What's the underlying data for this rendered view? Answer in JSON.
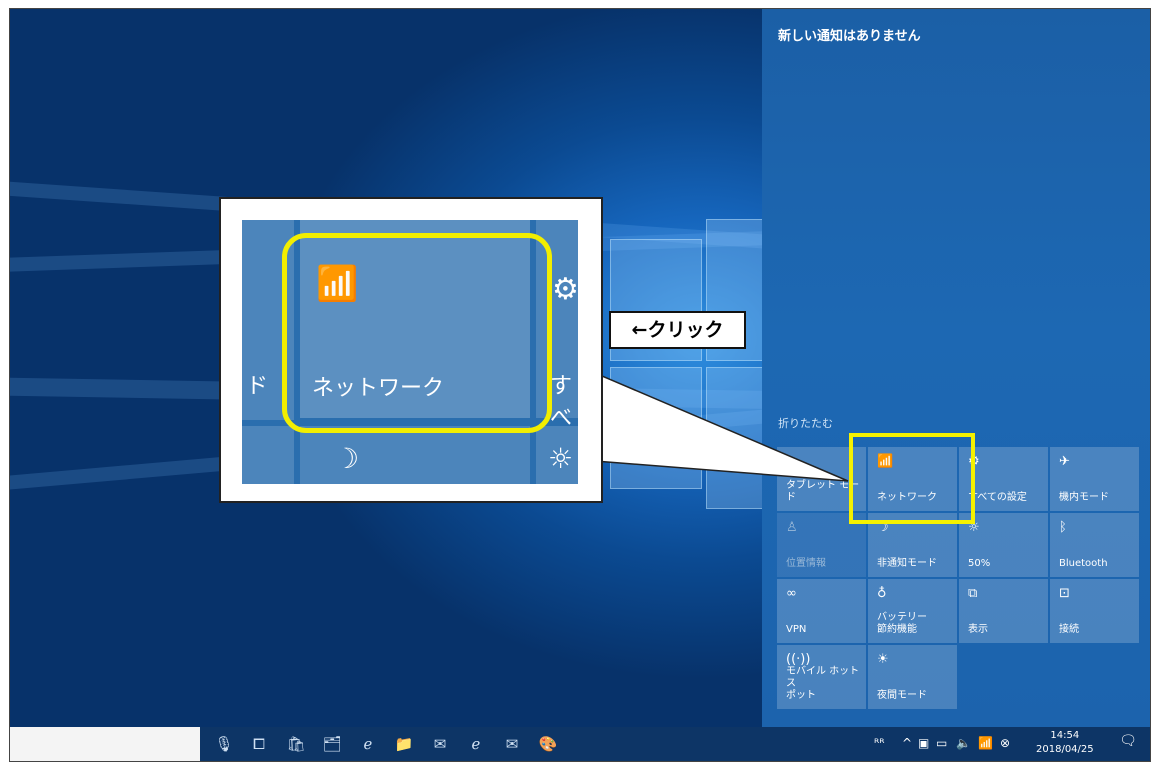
{
  "action_center": {
    "no_notifications": "新しい通知はありません",
    "collapse": "折りたたむ",
    "tiles": [
      {
        "label": "タブレット モード",
        "icon": "tablet-mode-icon",
        "glyph": "",
        "active": true
      },
      {
        "label": "ネットワーク",
        "icon": "network-icon",
        "glyph": "📶",
        "active": true
      },
      {
        "label": "すべての設定",
        "icon": "gear-icon",
        "glyph": "⚙",
        "active": true
      },
      {
        "label": "機内モード",
        "icon": "airplane-icon",
        "glyph": "✈",
        "active": true
      },
      {
        "label": "位置情報",
        "icon": "location-icon",
        "glyph": "♙",
        "active": false
      },
      {
        "label": "非通知モード",
        "icon": "moon-icon",
        "glyph": "☽",
        "active": true
      },
      {
        "label": "50%",
        "icon": "brightness-icon",
        "glyph": "☼",
        "active": true
      },
      {
        "label": "Bluetooth",
        "icon": "bluetooth-icon",
        "glyph": "ᛒ",
        "active": true
      },
      {
        "label": "VPN",
        "icon": "vpn-icon",
        "glyph": "∞",
        "active": true
      },
      {
        "label": "バッテリー\n節約機能",
        "icon": "battery-saver-icon",
        "glyph": "♁",
        "active": true
      },
      {
        "label": "表示",
        "icon": "project-icon",
        "glyph": "⧉",
        "active": true
      },
      {
        "label": "接続",
        "icon": "connect-icon",
        "glyph": "⊡",
        "active": true
      },
      {
        "label": "モバイル ホットス\nポット",
        "icon": "mobile-hotspot-icon",
        "glyph": "((·))",
        "active": true
      },
      {
        "label": "夜間モード",
        "icon": "night-light-icon",
        "glyph": "☀",
        "active": true
      }
    ]
  },
  "callout": {
    "zoom_label": "ネットワーク",
    "instruction": "←クリック",
    "left_fragment": "ド",
    "right_fragment": "すべ"
  },
  "taskbar": {
    "time": "14:54",
    "date": "2018/04/25",
    "tray_people": "ᴿᴿ",
    "tray_chevron": "^"
  }
}
